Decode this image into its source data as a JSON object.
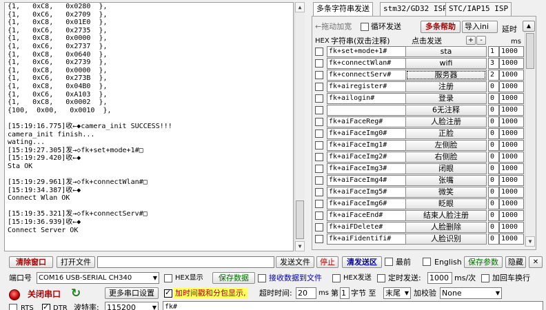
{
  "log": {
    "lines": [
      "{1,   0xC8,   0x0280  },",
      "{1,   0xC6,   0x2709  },",
      "{1,   0xC8,   0x01E0  },",
      "{1,   0xC6,   0x2735  },",
      "{1,   0xC8,   0x0000  },",
      "{1,   0xC6,   0x2737  },",
      "{1,   0xC8,   0x0640  },",
      "{1,   0xC6,   0x2739  },",
      "{1,   0xC8,   0x0000  },",
      "{1,   0xC6,   0x273B  },",
      "{1,   0xC8,   0x04B0  },",
      "{1,   0xC6,   0xA103  },",
      "{1,   0xC8,   0x0002  },",
      "{100,  0x00,   0x0010  },",
      "",
      "[15:19:16.775]收←◆camera_init SUCCESS!!!",
      "camera_init finish...",
      "wating...",
      "[15:19:27.305]发→◇fk+set+mode+1#□",
      "[15:19:29.420]收←◆",
      "Sta OK",
      "",
      "[15:19:29.961]发→◇fk+connectWlan#□",
      "[15:19:34.387]收←◆",
      "Connect Wlan OK",
      "",
      "[15:19:35.321]发→◇fk+connectServ#□",
      "[15:19:36.939]收←◆",
      "Connect Server OK"
    ]
  },
  "tabs": [
    {
      "label": "多条字符串发送"
    },
    {
      "label": "stm32/GD32 ISP"
    },
    {
      "label": "STC/IAP15 ISP"
    }
  ],
  "panel": {
    "drag_label": "←拖动加宽",
    "loop_label": "循环发送",
    "help_label": "多条帮助",
    "import_label": "导入ini",
    "delay_label": "延时",
    "hex_header": "HEX",
    "string_header": "字符串(双击注释)",
    "send_header": "点击发送",
    "plus": "+",
    "minus": "-",
    "ms_header": "ms"
  },
  "rows": [
    {
      "cmd": "fk+set+mode+1#",
      "send": "sta",
      "ord": "1",
      "delay": "1000"
    },
    {
      "cmd": "fk+connectWlan#",
      "send": "wifi",
      "ord": "3",
      "delay": "1000"
    },
    {
      "cmd": "fk+connectServ#",
      "send": "服务器",
      "ord": "2",
      "delay": "1000"
    },
    {
      "cmd": "fk+airegister#",
      "send": "注册",
      "ord": "0",
      "delay": "1000"
    },
    {
      "cmd": "fk+ailogin#",
      "send": "登录",
      "ord": "0",
      "delay": "1000"
    },
    {
      "cmd": "",
      "send": "6无注释",
      "ord": "0",
      "delay": "1000"
    },
    {
      "cmd": "fk+aiFaceReg#",
      "send": "人脸注册",
      "ord": "0",
      "delay": "1000"
    },
    {
      "cmd": "fk+aiFaceImg0#",
      "send": "正脸",
      "ord": "0",
      "delay": "1000"
    },
    {
      "cmd": "fk+aiFaceImg1#",
      "send": "左侧脸",
      "ord": "0",
      "delay": "1000"
    },
    {
      "cmd": "fk+aiFaceImg2#",
      "send": "右侧脸",
      "ord": "0",
      "delay": "1000"
    },
    {
      "cmd": "fk+aiFaceImg3#",
      "send": "闭眼",
      "ord": "0",
      "delay": "1000"
    },
    {
      "cmd": "fk+aiFaceImg4#",
      "send": "张嘴",
      "ord": "0",
      "delay": "1000"
    },
    {
      "cmd": "fk+aiFaceImg5#",
      "send": "微笑",
      "ord": "0",
      "delay": "1000"
    },
    {
      "cmd": "fk+aiFaceImg6#",
      "send": "眨眼",
      "ord": "0",
      "delay": "1000"
    },
    {
      "cmd": "fk+aiFaceEnd#",
      "send": "结束人脸注册",
      "ord": "0",
      "delay": "1000"
    },
    {
      "cmd": "fk+aiFDelete#",
      "send": "人脸删除",
      "ord": "0",
      "delay": "1000"
    },
    {
      "cmd": "fk+aiFidentifi#",
      "send": "人脸识别",
      "ord": "0",
      "delay": "1000"
    }
  ],
  "toolbar": {
    "clear_window": "清除窗口",
    "open_file": "打开文件",
    "send_file": "发送文件",
    "stop": "停止",
    "clear_send": "清发送区",
    "topmost": "最前",
    "english": "English",
    "save_params": "保存参数",
    "hide": "隐藏",
    "close": "✕"
  },
  "port": {
    "port_label": "端口号",
    "port_value": "COM16 USB-SERIAL CH340",
    "hex_display": "HEX显示",
    "save_data": "保存数据",
    "recv_to_file": "接收数据到文件",
    "hex_send": "HEX发送",
    "timed_send": "定时发送:",
    "interval": "1000",
    "interval_unit": "ms/次",
    "add_crlf": "加回车换行",
    "close_port": "关闭串口",
    "more_settings": "更多串口设置",
    "timestamp": "加时间戳和分包显示,",
    "timeout_label": "超时时间:",
    "timeout_value": "20",
    "ms": "ms",
    "nth_label": "第",
    "nth_value": "1",
    "byte_to": "字节 至",
    "end_value": "末尾",
    "checksum_label": "加校验",
    "checksum_value": "None",
    "rts": "RTS",
    "dtr": "DTR",
    "baud_label": "波特率:",
    "baud_value": "115200",
    "send_text": "fk#"
  },
  "colors": {
    "red_text": "#b00000",
    "green_text": "#007000",
    "blue_text": "#0000b0",
    "timestamp_highlight": "#ffff60"
  }
}
